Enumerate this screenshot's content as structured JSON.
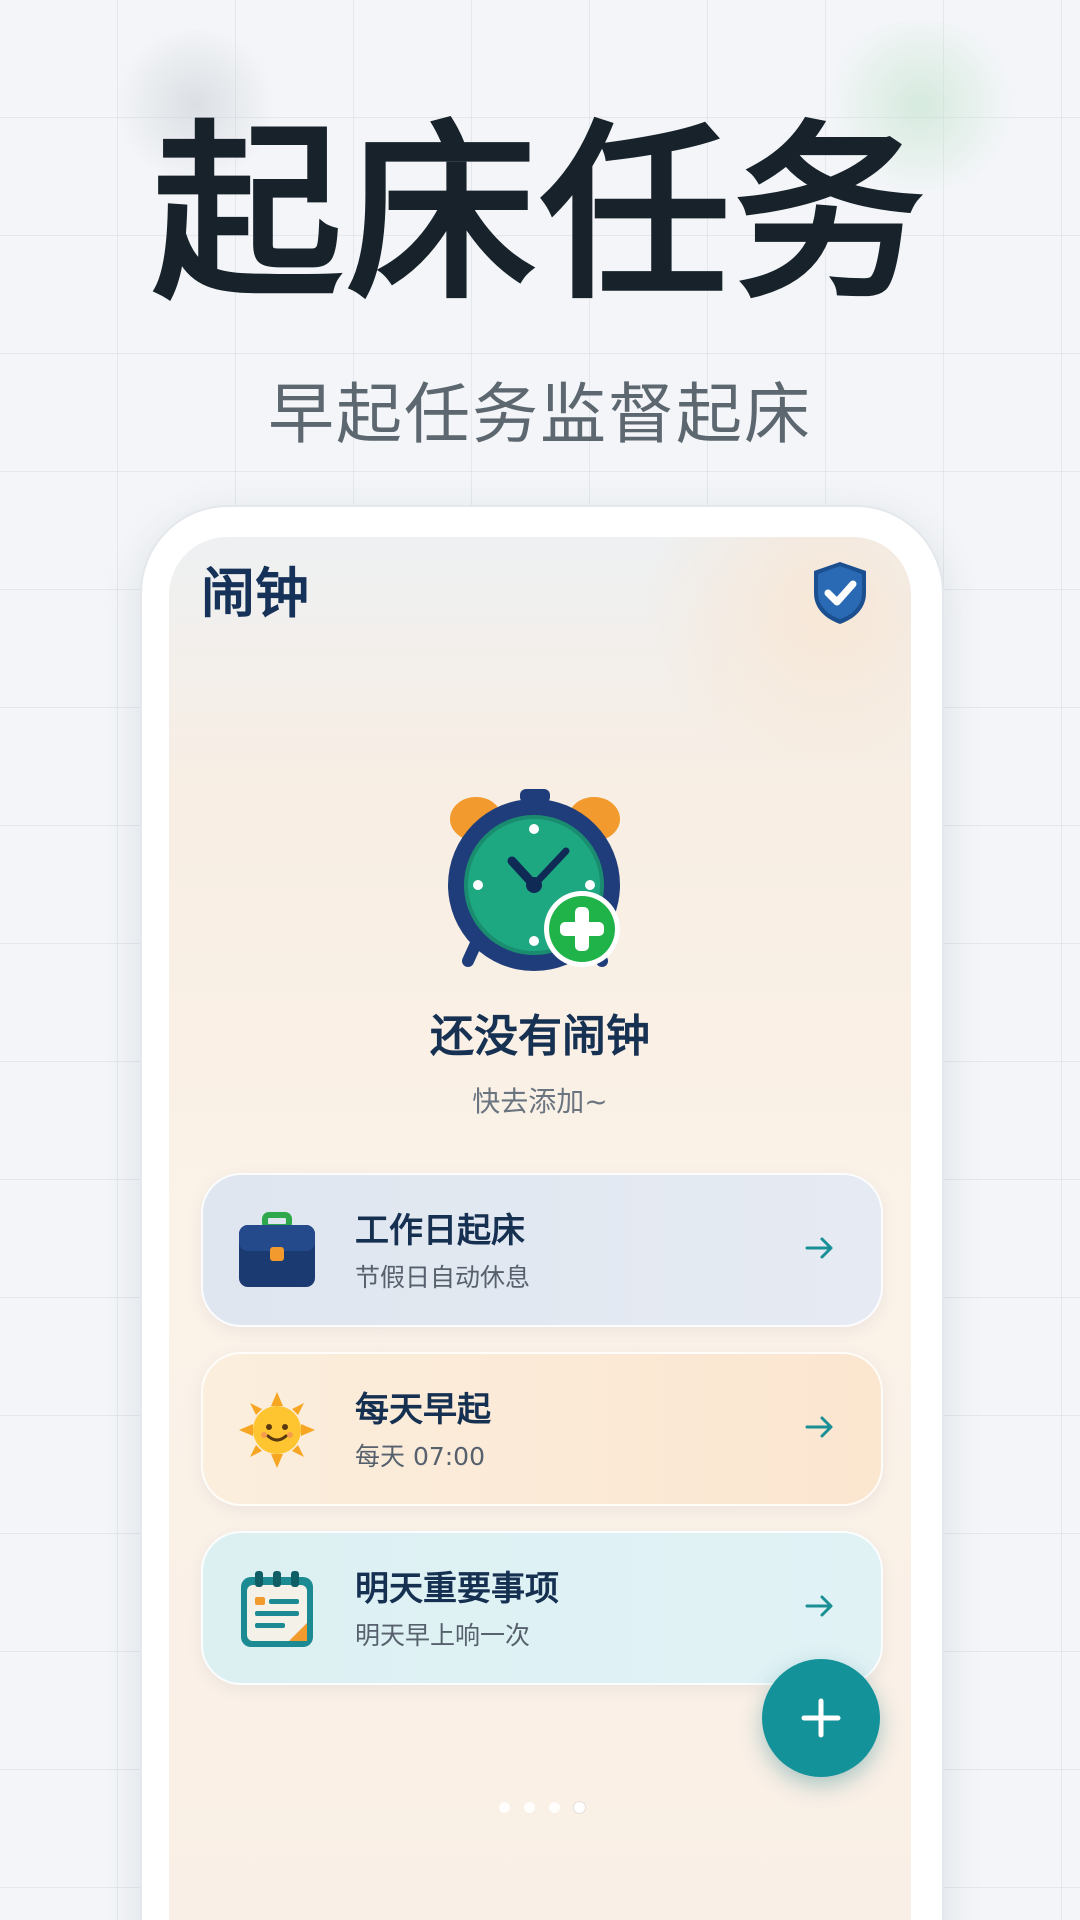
{
  "headline": "起床任务",
  "subheadline": "早起任务监督起床",
  "app": {
    "title": "闹钟",
    "header_icon": "shield-check-icon"
  },
  "empty_state": {
    "icon": "alarm-clock-add-icon",
    "title": "还没有闹钟",
    "subtitle": "快去添加~"
  },
  "cards": [
    {
      "icon": "briefcase-icon",
      "title": "工作日起床",
      "subtitle": "节假日自动休息",
      "arrow": "arrow-right-icon"
    },
    {
      "icon": "sun-icon",
      "title": "每天早起",
      "subtitle": "每天 07:00",
      "arrow": "arrow-right-icon"
    },
    {
      "icon": "notepad-icon",
      "title": "明天重要事项",
      "subtitle": "明天早上响一次",
      "arrow": "arrow-right-icon"
    }
  ],
  "fab": {
    "icon": "plus-icon"
  },
  "pagination": {
    "count": 4,
    "active_index": 3
  },
  "colors": {
    "title_text": "#163258",
    "accent_teal": "#14929a",
    "headline_text": "#17222b"
  }
}
